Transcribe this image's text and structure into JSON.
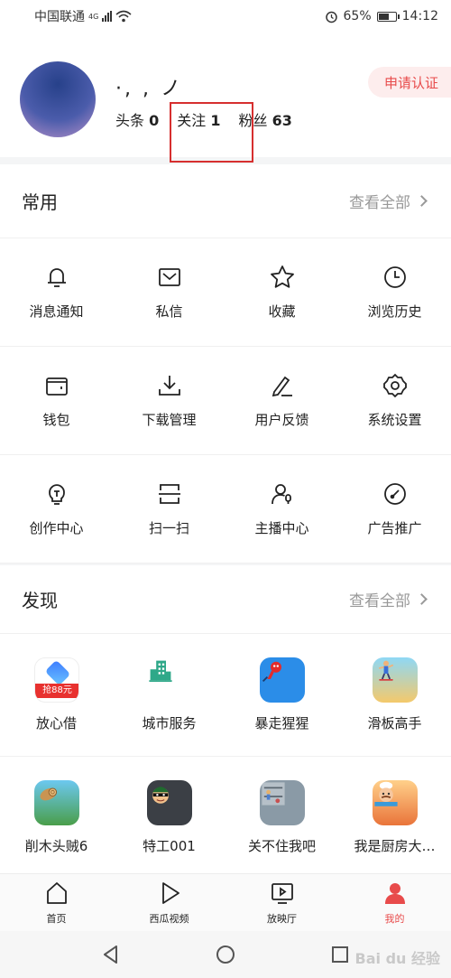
{
  "status_bar": {
    "carrier": "中国联通",
    "network": "4G",
    "battery_pct": "65%",
    "battery_level": 0.65,
    "time": "14:12"
  },
  "profile": {
    "username": "·, ,  ノ",
    "stats": [
      {
        "label": "头条",
        "value": "0"
      },
      {
        "label": "关注",
        "value": "1"
      },
      {
        "label": "粉丝",
        "value": "63"
      }
    ],
    "verify_label": "申请认证"
  },
  "common": {
    "title": "常用",
    "see_all": "查看全部",
    "items": [
      {
        "label": "消息通知",
        "icon": "bell-icon"
      },
      {
        "label": "私信",
        "icon": "mail-icon"
      },
      {
        "label": "收藏",
        "icon": "star-icon"
      },
      {
        "label": "浏览历史",
        "icon": "clock-icon"
      },
      {
        "label": "钱包",
        "icon": "wallet-icon"
      },
      {
        "label": "下载管理",
        "icon": "download-icon"
      },
      {
        "label": "用户反馈",
        "icon": "pencil-icon"
      },
      {
        "label": "系统设置",
        "icon": "gear-icon"
      },
      {
        "label": "创作中心",
        "icon": "lightbulb-icon"
      },
      {
        "label": "扫一扫",
        "icon": "scan-icon"
      },
      {
        "label": "主播中心",
        "icon": "streamer-icon"
      },
      {
        "label": "广告推广",
        "icon": "gauge-icon"
      }
    ]
  },
  "discover": {
    "title": "发现",
    "see_all": "查看全部",
    "items": [
      {
        "label": "放心借",
        "icon": "loan-app-icon",
        "badge": "抢88元"
      },
      {
        "label": "城市服务",
        "icon": "city-service-icon"
      },
      {
        "label": "暴走猩猩",
        "icon": "game-ape-icon"
      },
      {
        "label": "滑板高手",
        "icon": "game-skateboard-icon"
      },
      {
        "label": "削木头贼6",
        "icon": "game-wood-icon"
      },
      {
        "label": "特工001",
        "icon": "game-agent-icon"
      },
      {
        "label": "关不住我吧",
        "icon": "game-escape-icon"
      },
      {
        "label": "我是厨房大…",
        "icon": "game-chef-icon"
      }
    ]
  },
  "tabbar": {
    "tabs": [
      {
        "label": "首页",
        "icon": "home-icon"
      },
      {
        "label": "西瓜视频",
        "icon": "play-icon"
      },
      {
        "label": "放映厅",
        "icon": "tv-icon"
      },
      {
        "label": "我的",
        "icon": "profile-icon",
        "active": true
      }
    ],
    "active_color": "#e84b4b"
  },
  "watermark": "Bai du 经验"
}
